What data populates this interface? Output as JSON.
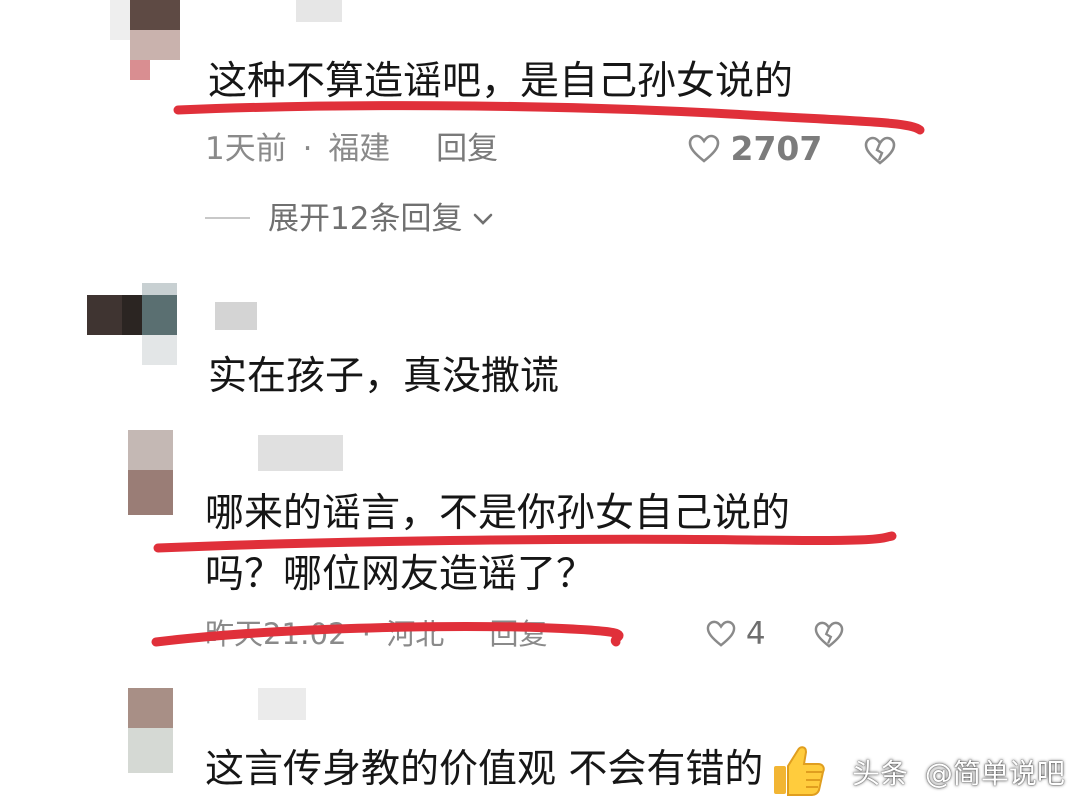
{
  "comments": [
    {
      "text": "这种不算造谣吧，是自己孙女说的",
      "time": "1天前",
      "sep": "·",
      "location": "福建",
      "reply": "回复",
      "likes": "2707",
      "expand": "展开12条回复"
    },
    {
      "text": "实在孩子，真没撒谎"
    },
    {
      "text_line1": "哪来的谣言，不是你孙女自己说的",
      "text_line2": "吗？哪位网友造谣了？",
      "time": "昨天21:02",
      "sep": "·",
      "location": "河北",
      "reply": "回复",
      "likes": "4"
    },
    {
      "text": "这言传身教的价值观 不会有错的"
    }
  ],
  "watermark": {
    "platform": "头条",
    "handle": "@简单说吧"
  },
  "colors": {
    "text": "#161616",
    "meta": "#8a8a8a",
    "annotation_red": "#e0303a"
  },
  "icons": [
    "heart-outline-icon",
    "broken-heart-icon",
    "chevron-down-icon",
    "thumbs-up-emoji"
  ]
}
